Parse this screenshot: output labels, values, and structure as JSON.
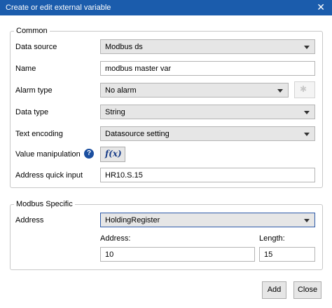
{
  "window": {
    "title": "Create or edit external variable",
    "close_glyph": "✕"
  },
  "common": {
    "legend": "Common",
    "data_source": {
      "label": "Data source",
      "value": "Modbus ds"
    },
    "name": {
      "label": "Name",
      "value": "modbus master var"
    },
    "alarm_type": {
      "label": "Alarm type",
      "value": "No alarm",
      "star_glyph": "✱"
    },
    "data_type": {
      "label": "Data type",
      "value": "String"
    },
    "text_encoding": {
      "label": "Text encoding",
      "value": "Datasource setting"
    },
    "value_manipulation": {
      "label": "Value manipulation",
      "help_glyph": "?",
      "fx_glyph": "f(x)"
    },
    "address_quick_input": {
      "label": "Address quick input",
      "value": "HR10.S.15"
    }
  },
  "modbus": {
    "legend": "Modbus Specific",
    "address": {
      "label": "Address",
      "value": "HoldingRegister"
    },
    "address_number": {
      "label": "Address:",
      "value": "10"
    },
    "length": {
      "label": "Length:",
      "value": "15"
    }
  },
  "buttons": {
    "add": "Add",
    "close": "Close"
  }
}
